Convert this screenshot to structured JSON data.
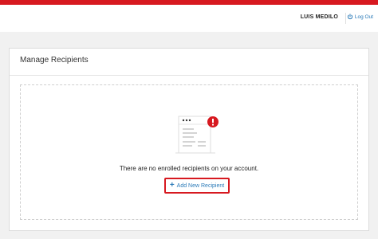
{
  "header": {
    "user_name": "LUIS MEDILO",
    "logout_label": "Log Out"
  },
  "panel": {
    "title": "Manage Recipients",
    "empty_message": "There are no enrolled recipients on your account.",
    "add_button_label": "Add New Recipient",
    "add_button_icon": "plus-icon"
  },
  "colors": {
    "brand_red": "#d71920",
    "link_blue": "#2a7ab8"
  }
}
